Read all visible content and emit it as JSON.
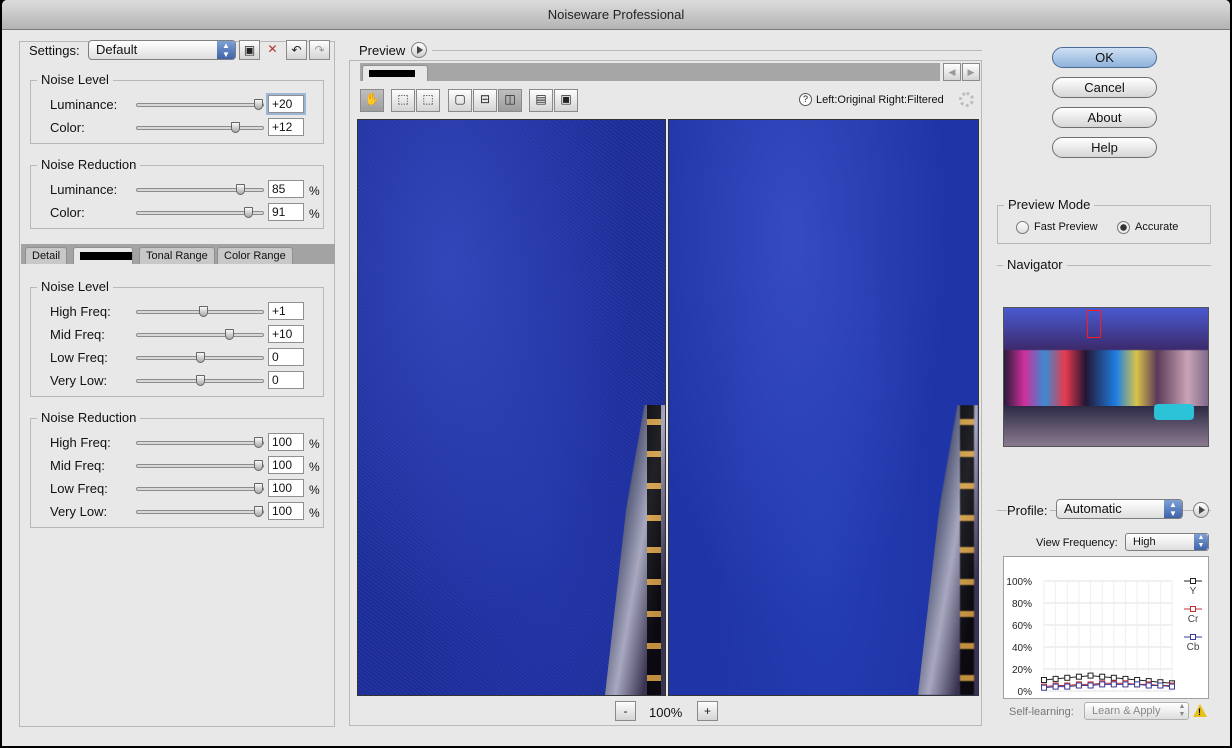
{
  "window": {
    "title": "Noiseware Professional"
  },
  "settings": {
    "label": "Settings:",
    "preset": "Default",
    "save_icon": "save-icon",
    "delete_icon": "delete-icon",
    "undo_icon": "undo-icon",
    "redo_icon": "redo-icon"
  },
  "noise_level": {
    "title": "Noise Level",
    "rows": [
      {
        "label": "Luminance:",
        "value": "+20",
        "level": 0.96
      },
      {
        "label": "Color:",
        "value": "+12",
        "level": 0.78
      }
    ]
  },
  "noise_reduction": {
    "title": "Noise Reduction",
    "unit": "%",
    "rows": [
      {
        "label": "Luminance:",
        "value": "85",
        "level": 0.82
      },
      {
        "label": "Color:",
        "value": "91",
        "level": 0.88
      }
    ]
  },
  "tabs": [
    {
      "label": "Detail"
    },
    {
      "label": ""
    },
    {
      "label": "Tonal Range"
    },
    {
      "label": "Color Range"
    }
  ],
  "freq_noise_level": {
    "title": "Noise Level",
    "rows": [
      {
        "label": "High Freq:",
        "value": "+1",
        "level": 0.52
      },
      {
        "label": "Mid Freq:",
        "value": "+10",
        "level": 0.73
      },
      {
        "label": "Low Freq:",
        "value": "0",
        "level": 0.5
      },
      {
        "label": "Very Low:",
        "value": "0",
        "level": 0.5
      }
    ]
  },
  "freq_noise_reduction": {
    "title": "Noise Reduction",
    "unit": "%",
    "rows": [
      {
        "label": "High Freq:",
        "value": "100",
        "level": 0.96
      },
      {
        "label": "Mid Freq:",
        "value": "100",
        "level": 0.96
      },
      {
        "label": "Low Freq:",
        "value": "100",
        "level": 0.96
      },
      {
        "label": "Very Low:",
        "value": "100",
        "level": 0.96
      }
    ]
  },
  "preview": {
    "title": "Preview",
    "tab_label": "",
    "hint_icon": "?",
    "hint_text": "Left:Original Right:Filtered",
    "zoom": "100%",
    "zoom_out": "-",
    "zoom_in": "+"
  },
  "buttons": {
    "ok": "OK",
    "cancel": "Cancel",
    "about": "About",
    "help": "Help"
  },
  "preview_mode": {
    "title": "Preview Mode",
    "options": [
      {
        "label": "Fast Preview",
        "selected": false
      },
      {
        "label": "Accurate",
        "selected": true
      }
    ]
  },
  "navigator": {
    "title": "Navigator"
  },
  "profile": {
    "label": "Profile:",
    "value": "Automatic",
    "view_freq_label": "View Frequency:",
    "view_freq_value": "High",
    "self_learning_label": "Self-learning:",
    "learn_apply": "Learn & Apply"
  },
  "chart_data": {
    "type": "line",
    "y_ticks": [
      "100%",
      "80%",
      "60%",
      "40%",
      "20%",
      "0%"
    ],
    "ylim": [
      0,
      100
    ],
    "x": [
      1,
      2,
      3,
      4,
      5,
      6,
      7,
      8,
      9,
      10,
      11,
      12
    ],
    "series": [
      {
        "name": "Y",
        "color": "#222222",
        "values": [
          10,
          11,
          12,
          13,
          14,
          13,
          12,
          11,
          10,
          9,
          8,
          7
        ]
      },
      {
        "name": "Cr",
        "color": "#c03030",
        "values": [
          4,
          5,
          5,
          6,
          6,
          7,
          7,
          7,
          6,
          6,
          5,
          5
        ]
      },
      {
        "name": "Cb",
        "color": "#3a3a9a",
        "values": [
          3,
          4,
          4,
          5,
          5,
          6,
          6,
          6,
          6,
          5,
          5,
          4
        ]
      }
    ]
  }
}
